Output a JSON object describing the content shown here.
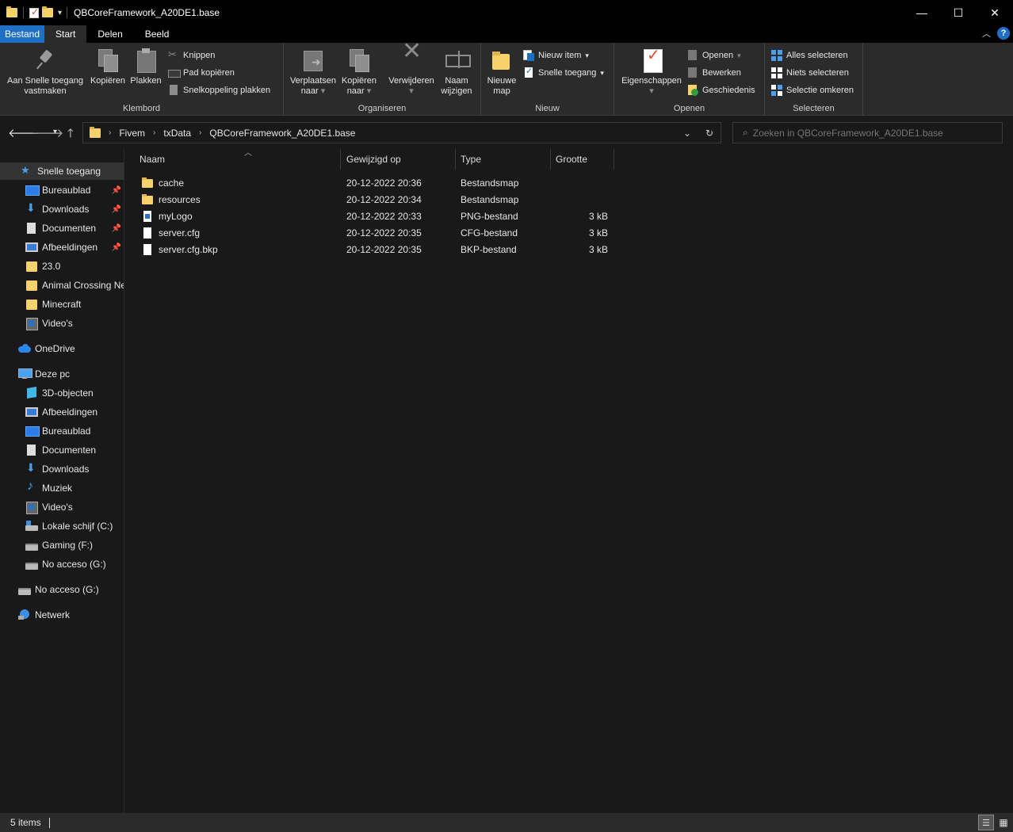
{
  "window": {
    "title": "QBCoreFramework_A20DE1.base",
    "minimize": "—",
    "maximize": "☐",
    "close": "✕"
  },
  "tabs": [
    {
      "label": "Bestand"
    },
    {
      "label": "Start"
    },
    {
      "label": "Delen"
    },
    {
      "label": "Beeld"
    }
  ],
  "ribbon": {
    "clipboard": {
      "label": "Klembord",
      "pin_label": "Aan Snelle toegang vastmaken",
      "pin_line1": "Aan Snelle toegang",
      "pin_line2": "vastmaken",
      "copy": "Kopiëren",
      "paste": "Plakken",
      "cut": "Knippen",
      "copy_path": "Pad kopiëren",
      "paste_shortcut": "Snelkoppeling plakken"
    },
    "organize": {
      "label": "Organiseren",
      "move_line1": "Verplaatsen",
      "move_line2": "naar",
      "copyto_line1": "Kopiëren",
      "copyto_line2": "naar",
      "delete": "Verwijderen",
      "rename_line1": "Naam",
      "rename_line2": "wijzigen"
    },
    "new": {
      "label": "Nieuw",
      "newfolder_line1": "Nieuwe",
      "newfolder_line2": "map",
      "new_item": "Nieuw item",
      "easy_access": "Snelle toegang"
    },
    "open": {
      "label": "Openen",
      "properties": "Eigenschappen",
      "open": "Openen",
      "edit": "Bewerken",
      "history": "Geschiedenis"
    },
    "select": {
      "label": "Selecteren",
      "select_all": "Alles selecteren",
      "select_none": "Niets selecteren",
      "invert": "Selectie omkeren"
    }
  },
  "address": {
    "crumbs": [
      "Fivem",
      "txData",
      "QBCoreFramework_A20DE1.base"
    ]
  },
  "search": {
    "placeholder": "Zoeken in QBCoreFramework_A20DE1.base"
  },
  "sidebar": {
    "items": [
      {
        "label": "Snelle toegang"
      },
      {
        "label": "Bureaublad"
      },
      {
        "label": "Downloads"
      },
      {
        "label": "Documenten"
      },
      {
        "label": "Afbeeldingen"
      },
      {
        "label": "23.0"
      },
      {
        "label": "Animal Crossing New Horizons"
      },
      {
        "label": "Minecraft"
      },
      {
        "label": "Video's"
      },
      {
        "label": "OneDrive"
      },
      {
        "label": "Deze pc"
      },
      {
        "label": "3D-objecten"
      },
      {
        "label": "Afbeeldingen"
      },
      {
        "label": "Bureaublad"
      },
      {
        "label": "Documenten"
      },
      {
        "label": "Downloads"
      },
      {
        "label": "Muziek"
      },
      {
        "label": "Video's"
      },
      {
        "label": "Lokale schijf (C:)"
      },
      {
        "label": "Gaming (F:)"
      },
      {
        "label": "No acceso (G:)"
      },
      {
        "label": "No acceso (G:)"
      },
      {
        "label": "Netwerk"
      }
    ]
  },
  "columns": {
    "name": "Naam",
    "modified": "Gewijzigd op",
    "type": "Type",
    "size": "Grootte"
  },
  "files": [
    {
      "name": "cache",
      "modified": "20-12-2022 20:36",
      "type": "Bestandsmap",
      "size": ""
    },
    {
      "name": "resources",
      "modified": "20-12-2022 20:34",
      "type": "Bestandsmap",
      "size": ""
    },
    {
      "name": "myLogo",
      "modified": "20-12-2022 20:33",
      "type": "PNG-bestand",
      "size": "3 kB"
    },
    {
      "name": "server.cfg",
      "modified": "20-12-2022 20:35",
      "type": "CFG-bestand",
      "size": "3 kB"
    },
    {
      "name": "server.cfg.bkp",
      "modified": "20-12-2022 20:35",
      "type": "BKP-bestand",
      "size": "3 kB"
    }
  ],
  "status": {
    "items": "5 items"
  }
}
